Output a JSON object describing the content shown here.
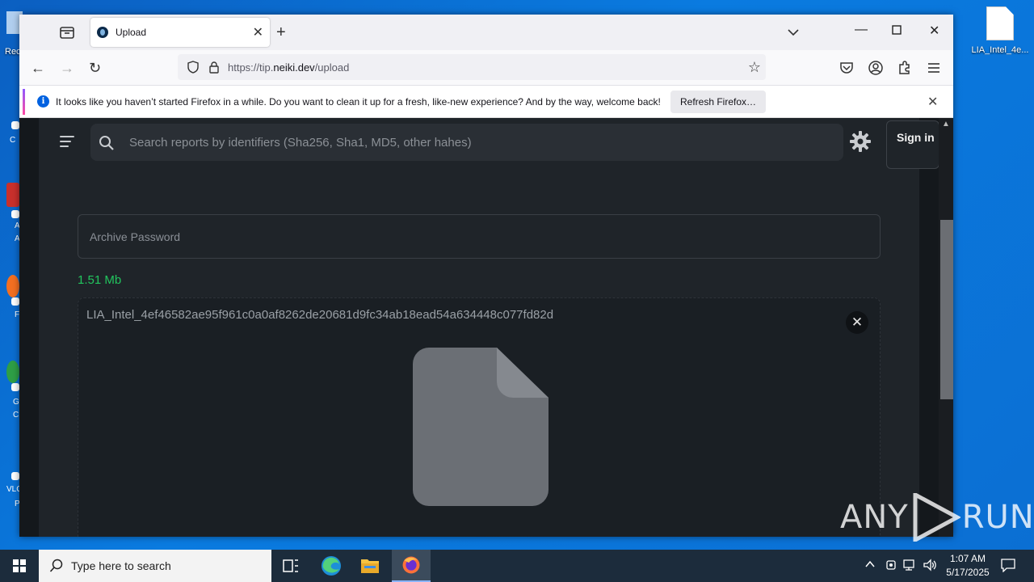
{
  "desktop": {
    "file_label": "LIA_Intel_4e...",
    "left_labels": [
      "Rec",
      "C",
      "A",
      "A",
      "F",
      "G",
      "C",
      "VLC",
      "P"
    ]
  },
  "browser": {
    "tab_title": "Upload",
    "url_prefix": "https://tip.",
    "url_domain": "neiki.dev",
    "url_path": "/upload",
    "notice_text": "It looks like you haven’t started Firefox in a while. Do you want to clean it up for a fresh, like-new experience? And by the way, welcome back!",
    "refresh_label": "Refresh Firefox…"
  },
  "site": {
    "search_placeholder": "Search reports by identifiers (Sha256, Sha1, MD5, other hahes)",
    "signin_label": "Sign in",
    "password_placeholder": "Archive Password",
    "file_size": "1.51 Mb",
    "file_name": "LIA_Intel_4ef46582ae95f961c0a0af8262de20681d9fc34ab18ead54a634448c077fd82d"
  },
  "watermark": {
    "left": "ANY",
    "right": "RUN"
  },
  "taskbar": {
    "search_placeholder": "Type here to search",
    "time": "1:07 AM",
    "date": "5/17/2025"
  },
  "colors": {
    "accent_green": "#22c55e",
    "page_bg": "#1f2429",
    "desktop_blue": "#0a74d8"
  }
}
